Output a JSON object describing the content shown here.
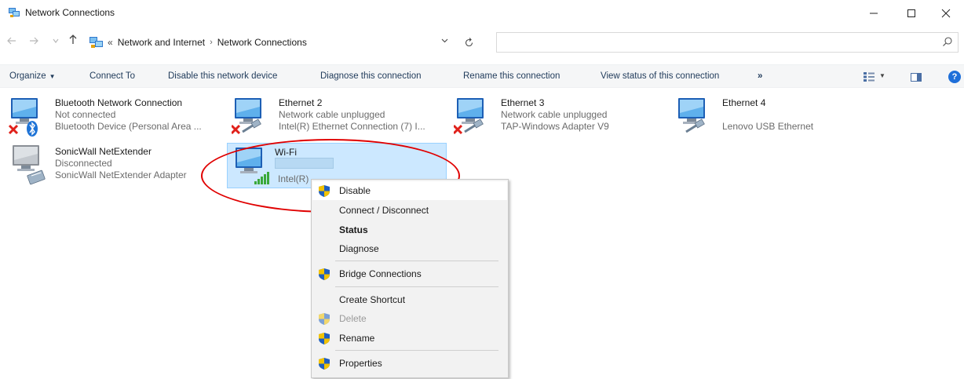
{
  "window": {
    "title": "Network Connections"
  },
  "address": {
    "overflow": "«",
    "crumbs": [
      "Network and Internet",
      "Network Connections"
    ],
    "separator": "›"
  },
  "search": {
    "placeholder": ""
  },
  "commands": {
    "organize": "Organize",
    "connect_to": "Connect To",
    "disable": "Disable this network device",
    "diagnose": "Diagnose this connection",
    "rename": "Rename this connection",
    "view_status": "View status of this connection",
    "more": "»"
  },
  "connections": [
    {
      "name": "Bluetooth Network Connection",
      "status": "Not connected",
      "device": "Bluetooth Device (Personal Area ...",
      "badge": "disconnected-x",
      "overlay": "bluetooth-icon"
    },
    {
      "name": "Ethernet 2",
      "status": "Network cable unplugged",
      "device": "Intel(R) Ethernet Connection (7) I...",
      "badge": "disconnected-x",
      "overlay": "ethernet-cable-icon"
    },
    {
      "name": "Ethernet 3",
      "status": "Network cable unplugged",
      "device": "TAP-Windows Adapter V9",
      "badge": "disconnected-x",
      "overlay": "ethernet-cable-icon"
    },
    {
      "name": "Ethernet 4",
      "status": "",
      "device": "Lenovo USB Ethernet",
      "badge": "",
      "overlay": "ethernet-cable-icon"
    },
    {
      "name": "SonicWall NetExtender",
      "status": "Disconnected",
      "device": "SonicWall NetExtender Adapter",
      "badge": "",
      "overlay": "vpn-adapter-icon"
    },
    {
      "name": "Wi-Fi",
      "status": "",
      "device": "Intel(R)",
      "badge": "",
      "overlay": "wifi-signal-icon",
      "selected": true
    }
  ],
  "context_menu": {
    "items": [
      {
        "label": "Disable",
        "shield": true
      },
      {
        "label": "Connect / Disconnect",
        "shield": false
      },
      {
        "label": "Status",
        "shield": false,
        "bold": true
      },
      {
        "label": "Diagnose",
        "shield": false
      },
      {
        "label": "Bridge Connections",
        "shield": true
      },
      {
        "label": "Create Shortcut",
        "shield": false
      },
      {
        "label": "Delete",
        "shield": true,
        "disabled": true
      },
      {
        "label": "Rename",
        "shield": true
      },
      {
        "label": "Properties",
        "shield": true
      }
    ]
  },
  "colors": {
    "selection": "#cce8ff",
    "annotation": "#e00000",
    "link_text": "#1f3a5a"
  }
}
